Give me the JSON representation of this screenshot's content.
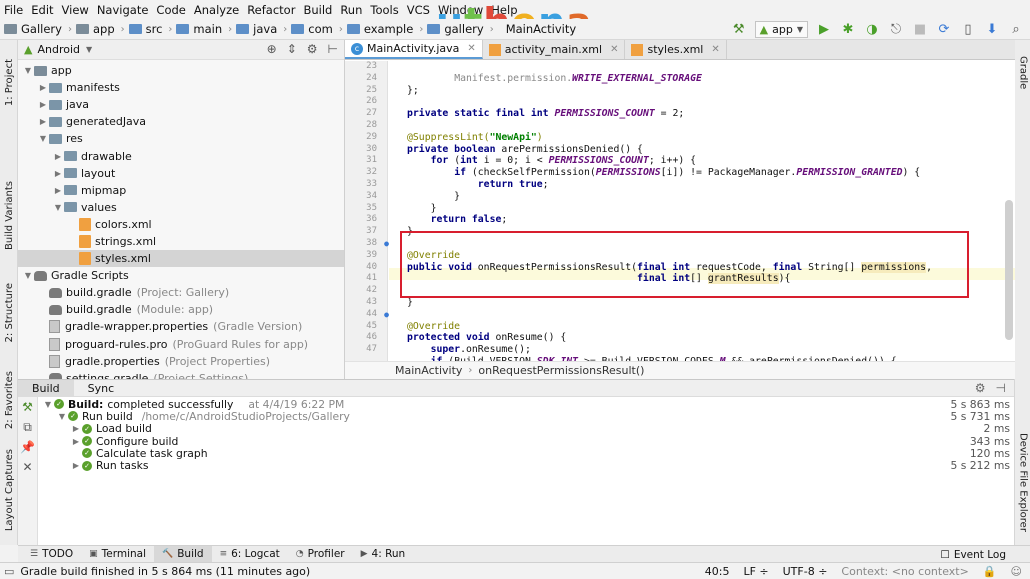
{
  "menu": [
    "File",
    "Edit",
    "View",
    "Navigate",
    "Code",
    "Analyze",
    "Refactor",
    "Build",
    "Run",
    "Tools",
    "VCS",
    "Window",
    "Help"
  ],
  "brand": [
    "u",
    "t",
    "h",
    "e",
    "n",
    "a"
  ],
  "breadcrumb": [
    "Gallery",
    "app",
    "src",
    "main",
    "java",
    "com",
    "example",
    "gallery"
  ],
  "breadcrumb_extra": "MainActivity",
  "run_config": "app",
  "left_tabs": [
    "1: Project",
    "Build Variants",
    "2: Structure",
    "2: Favorites",
    "Layout Captures"
  ],
  "right_tabs": [
    "Gradle",
    "Device File Explorer"
  ],
  "project": {
    "view": "Android",
    "tree": [
      {
        "label": "app",
        "hint": "",
        "depth": 0,
        "icon": "module",
        "arrow": "down"
      },
      {
        "label": "manifests",
        "hint": "",
        "depth": 1,
        "icon": "folder",
        "arrow": "right"
      },
      {
        "label": "java",
        "hint": "",
        "depth": 1,
        "icon": "folder",
        "arrow": "right"
      },
      {
        "label": "generatedJava",
        "hint": "",
        "depth": 1,
        "icon": "folder",
        "arrow": "right"
      },
      {
        "label": "res",
        "hint": "",
        "depth": 1,
        "icon": "folder",
        "arrow": "down"
      },
      {
        "label": "drawable",
        "hint": "",
        "depth": 2,
        "icon": "folder",
        "arrow": "right"
      },
      {
        "label": "layout",
        "hint": "",
        "depth": 2,
        "icon": "folder",
        "arrow": "right"
      },
      {
        "label": "mipmap",
        "hint": "",
        "depth": 2,
        "icon": "folder",
        "arrow": "right"
      },
      {
        "label": "values",
        "hint": "",
        "depth": 2,
        "icon": "folder",
        "arrow": "down"
      },
      {
        "label": "colors.xml",
        "hint": "",
        "depth": 3,
        "icon": "xml",
        "arrow": ""
      },
      {
        "label": "strings.xml",
        "hint": "",
        "depth": 3,
        "icon": "xml",
        "arrow": ""
      },
      {
        "label": "styles.xml",
        "hint": "",
        "depth": 3,
        "icon": "xml",
        "arrow": "",
        "selected": true
      },
      {
        "label": "Gradle Scripts",
        "hint": "",
        "depth": 0,
        "icon": "gradle",
        "arrow": "down"
      },
      {
        "label": "build.gradle",
        "hint": "(Project: Gallery)",
        "depth": 1,
        "icon": "gradle",
        "arrow": ""
      },
      {
        "label": "build.gradle",
        "hint": "(Module: app)",
        "depth": 1,
        "icon": "gradle",
        "arrow": ""
      },
      {
        "label": "gradle-wrapper.properties",
        "hint": "(Gradle Version)",
        "depth": 1,
        "icon": "file",
        "arrow": ""
      },
      {
        "label": "proguard-rules.pro",
        "hint": "(ProGuard Rules for app)",
        "depth": 1,
        "icon": "file",
        "arrow": ""
      },
      {
        "label": "gradle.properties",
        "hint": "(Project Properties)",
        "depth": 1,
        "icon": "file",
        "arrow": ""
      },
      {
        "label": "settings.gradle",
        "hint": "(Project Settings)",
        "depth": 1,
        "icon": "gradle",
        "arrow": ""
      }
    ]
  },
  "editor": {
    "tabs": [
      {
        "label": "MainActivity.java",
        "icon": "java",
        "active": true
      },
      {
        "label": "activity_main.xml",
        "icon": "xml",
        "active": false
      },
      {
        "label": "styles.xml",
        "icon": "xml",
        "active": false
      }
    ],
    "lines": [
      23,
      24,
      25,
      26,
      27,
      28,
      29,
      30,
      31,
      32,
      33,
      34,
      35,
      36,
      37,
      38,
      39,
      40,
      41,
      42,
      43,
      44,
      45,
      46,
      47
    ],
    "breadcrumb": [
      "MainActivity",
      "onRequestPermissionsResult()"
    ]
  },
  "build": {
    "tabs": [
      "Build",
      "Sync"
    ],
    "rows": [
      {
        "depth": 0,
        "arrow": "down",
        "label": "Build:",
        "bold": true,
        "rest": "completed successfully",
        "hint": "at 4/4/19 6:22 PM",
        "time": "5 s 863 ms"
      },
      {
        "depth": 1,
        "arrow": "down",
        "label": "Run build",
        "bold": false,
        "rest": "",
        "hint": "/home/c/AndroidStudioProjects/Gallery",
        "time": "5 s 731 ms"
      },
      {
        "depth": 2,
        "arrow": "right",
        "label": "Load build",
        "bold": false,
        "rest": "",
        "hint": "",
        "time": "2 ms"
      },
      {
        "depth": 2,
        "arrow": "right",
        "label": "Configure build",
        "bold": false,
        "rest": "",
        "hint": "",
        "time": "343 ms"
      },
      {
        "depth": 2,
        "arrow": "",
        "label": "Calculate task graph",
        "bold": false,
        "rest": "",
        "hint": "",
        "time": "120 ms"
      },
      {
        "depth": 2,
        "arrow": "right",
        "label": "Run tasks",
        "bold": false,
        "rest": "",
        "hint": "",
        "time": "5 s 212 ms"
      }
    ]
  },
  "bottom_tabs": [
    {
      "label": "TODO",
      "icon": "☰",
      "active": false
    },
    {
      "label": "Terminal",
      "icon": "▣",
      "active": false
    },
    {
      "label": "Build",
      "icon": "🔨",
      "active": true
    },
    {
      "label": "6: Logcat",
      "icon": "≡",
      "active": false
    },
    {
      "label": "Profiler",
      "icon": "◔",
      "active": false
    },
    {
      "label": "4: Run",
      "icon": "▶",
      "active": false
    }
  ],
  "event_log": "Event Log",
  "status": {
    "message": "Gradle build finished in 5 s 864 ms (11 minutes ago)",
    "position": "40:5",
    "line_sep": "LF",
    "encoding": "UTF-8",
    "context_label": "Context:",
    "context_value": "<no context>"
  },
  "colors": {
    "keyword": "#000080",
    "constant": "#660e7a",
    "annotation": "#808000",
    "string": "#008000",
    "highlight_box": "#d81e2e",
    "ok": "#5aa02c"
  }
}
